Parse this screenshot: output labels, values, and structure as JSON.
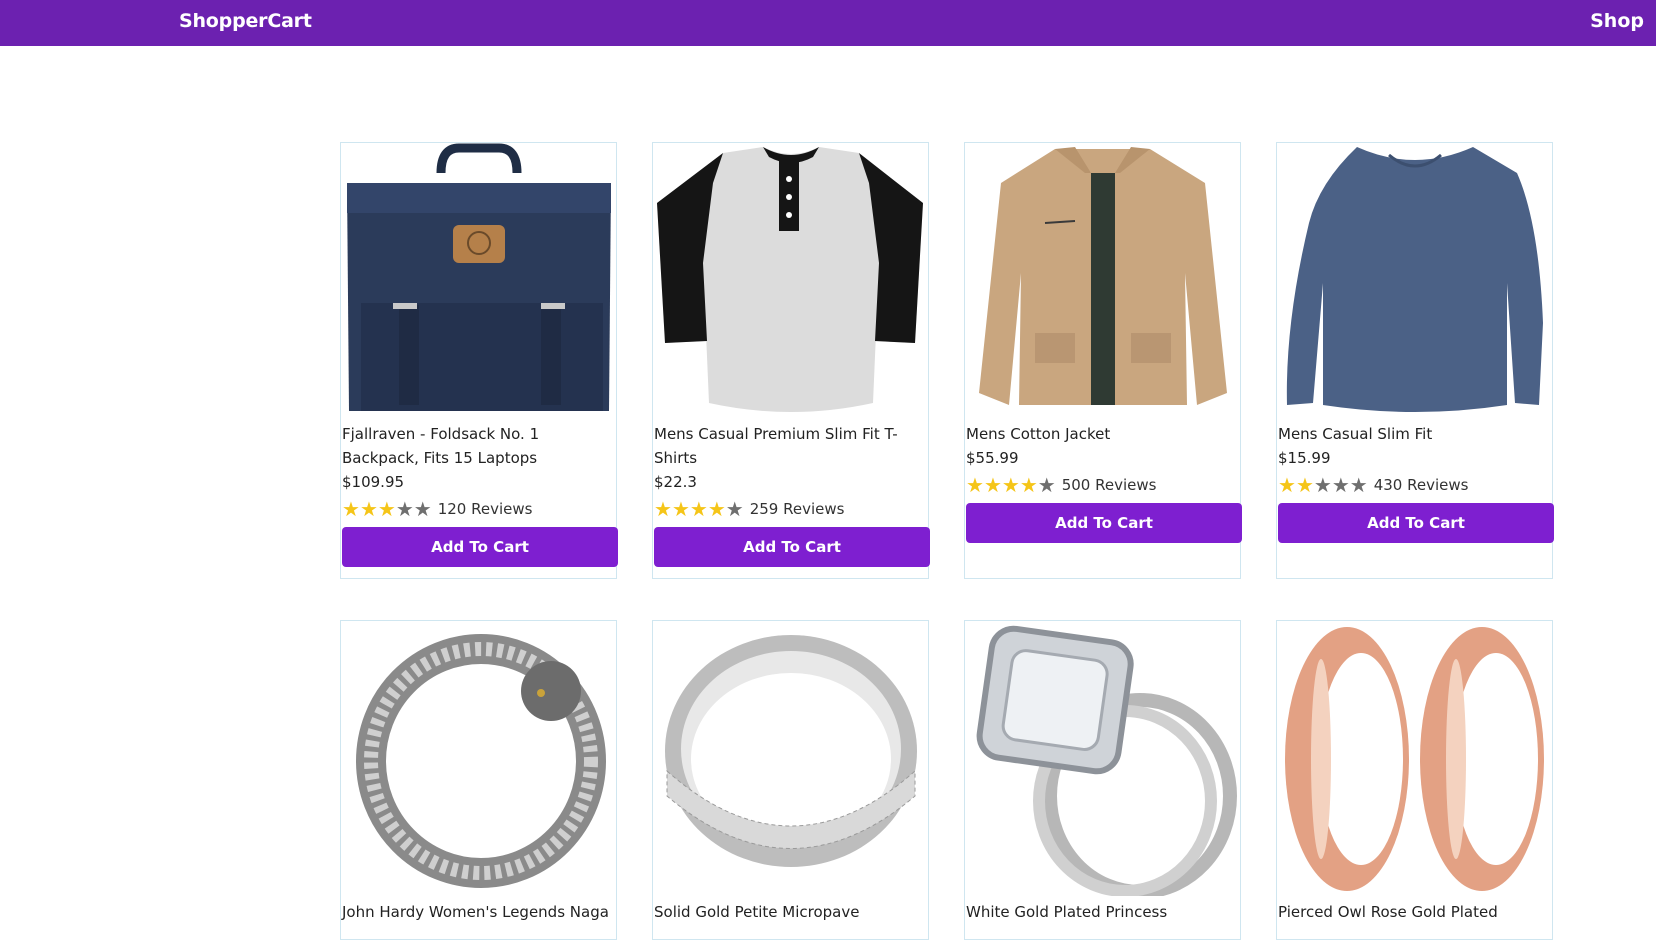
{
  "nav": {
    "brand": "ShopperCart",
    "shop_link": "Shop"
  },
  "colors": {
    "nav_bg": "#6c21b0",
    "button_bg": "#7e1fd0",
    "star_on": "#f5c518",
    "star_off": "#6f6f6f"
  },
  "products": [
    {
      "title": "Fjallraven - Foldsack No. 1 Backpack, Fits 15 Laptops",
      "price": "$109.95",
      "rating": 3,
      "reviews": "120 Reviews",
      "button": "Add To Cart",
      "image": "backpack"
    },
    {
      "title": "Mens Casual Premium Slim Fit T-Shirts",
      "price": "$22.3",
      "rating": 4,
      "reviews": "259 Reviews",
      "button": "Add To Cart",
      "image": "tshirt"
    },
    {
      "title": "Mens Cotton Jacket",
      "price": "$55.99",
      "rating": 4,
      "reviews": "500 Reviews",
      "button": "Add To Cart",
      "image": "jacket"
    },
    {
      "title": "Mens Casual Slim Fit",
      "price": "$15.99",
      "rating": 2,
      "reviews": "430 Reviews",
      "button": "Add To Cart",
      "image": "longsleeve"
    },
    {
      "title": "John Hardy Women's Legends Naga",
      "image": "bracelet"
    },
    {
      "title": "Solid Gold Petite Micropave",
      "image": "ring"
    },
    {
      "title": "White Gold Plated Princess",
      "image": "diamond-ring"
    },
    {
      "title": "Pierced Owl Rose Gold Plated",
      "image": "plugs"
    }
  ]
}
